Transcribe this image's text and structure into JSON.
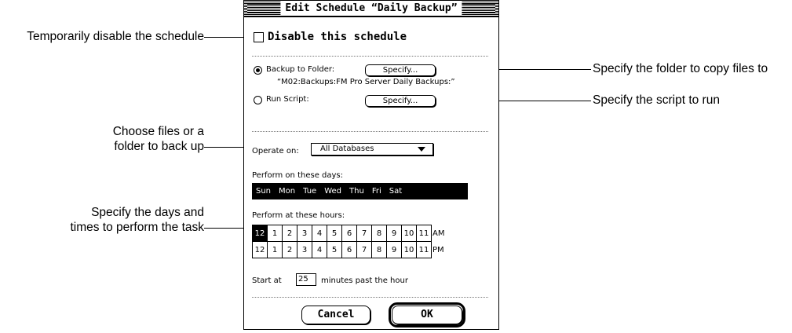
{
  "callouts": {
    "disable": "Temporarily disable the schedule",
    "folder": "Specify the folder to copy files to",
    "script": "Specify the script to run",
    "operate_line1": "Choose files or a",
    "operate_line2": "folder to back up",
    "days_line1": "Specify the days and",
    "days_line2": "times to perform the task"
  },
  "dialog": {
    "title": "Edit Schedule “Daily Backup”",
    "disable_label": "Disable this schedule",
    "disable_checked": false,
    "backup_label": "Backup to Folder:",
    "specify_label": "Specify...",
    "backup_path": "“M02:Backups:FM Pro Server Daily Backups:”",
    "run_script_label": "Run Script:",
    "selected_action": "backup_to_folder",
    "operate_on_label": "Operate on:",
    "operate_on_value": "All Databases",
    "days_label": "Perform on these days:",
    "days": [
      "Sun",
      "Mon",
      "Tue",
      "Wed",
      "Thu",
      "Fri",
      "Sat"
    ],
    "hours_label": "Perform at these hours:",
    "hours": [
      "12",
      "1",
      "2",
      "3",
      "4",
      "5",
      "6",
      "7",
      "8",
      "9",
      "10",
      "11"
    ],
    "am_label": "AM",
    "pm_label": "PM",
    "selected_hours_am": [
      "12"
    ],
    "start_at_label": "Start at",
    "start_minutes": "25",
    "minutes_suffix": "minutes past the hour",
    "cancel_label": "Cancel",
    "ok_label": "OK"
  }
}
